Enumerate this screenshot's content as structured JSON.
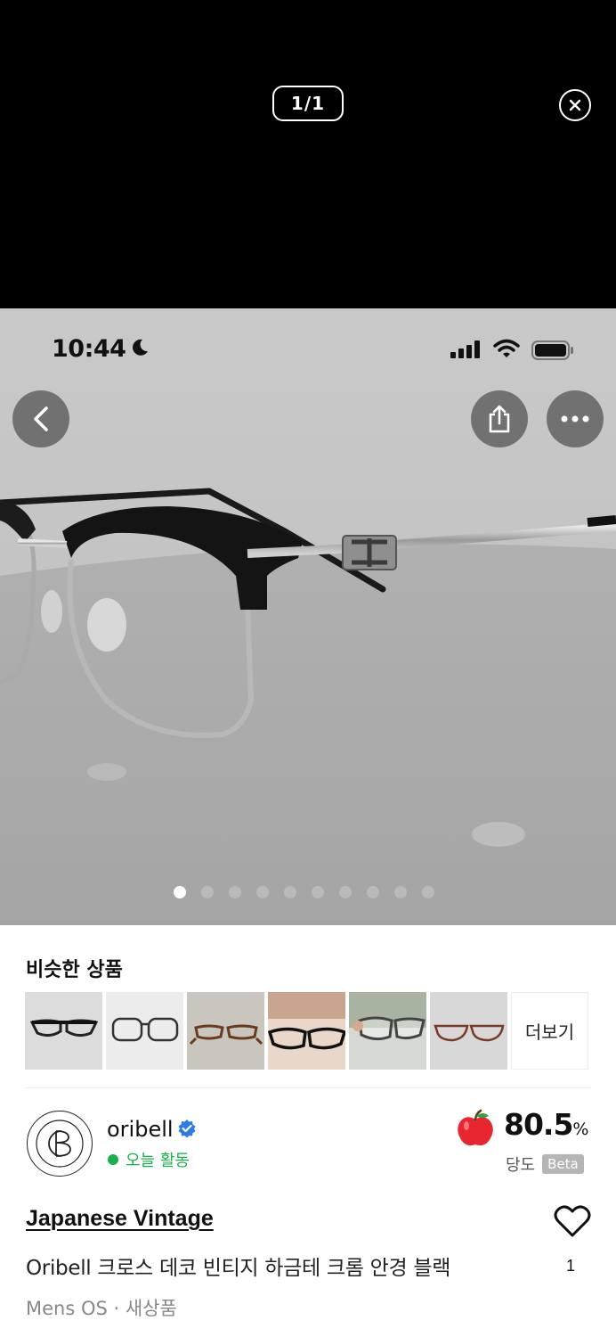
{
  "viewer": {
    "counter": "1/1"
  },
  "status_bar": {
    "time": "10:44"
  },
  "photo": {
    "carousel_total": 10,
    "carousel_active": 0
  },
  "similar": {
    "title": "비슷한 상품",
    "more_label": "더보기"
  },
  "seller": {
    "name": "oribell",
    "activity": "오늘 활동",
    "score": "80.5",
    "score_unit": "%",
    "sweetness_label": "당도",
    "beta_label": "Beta"
  },
  "product": {
    "brand": "Japanese Vintage",
    "title": "Oribell 크로스 데코 빈티지 하금테 크롬 안경 블랙",
    "like_count": "1",
    "meta": "Mens OS · 새상품"
  },
  "colors": {
    "accent_green": "#19b04b",
    "beta_bg": "#b5b5b5"
  }
}
